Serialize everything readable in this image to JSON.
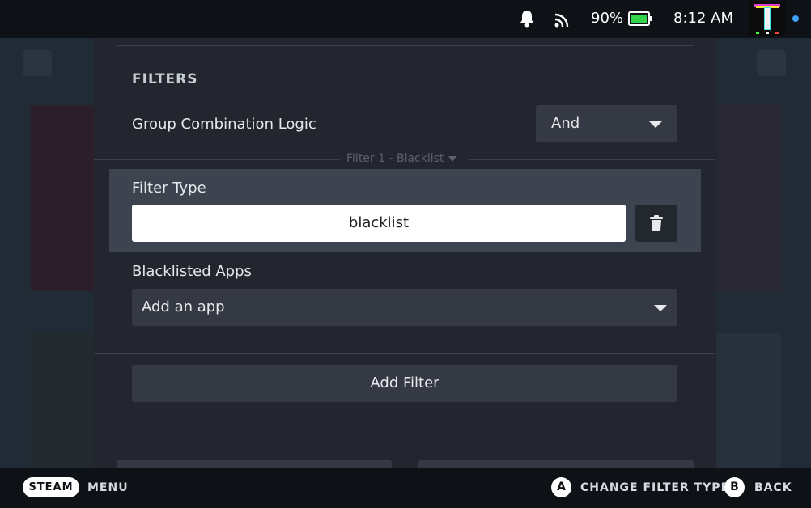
{
  "status_bar": {
    "battery_percent": "90%",
    "time": "8:12 AM",
    "avatar_letter": "T"
  },
  "filters_panel": {
    "section_title": "FILTERS",
    "group_logic": {
      "label": "Group Combination Logic",
      "selected": "And"
    },
    "filter_1": {
      "header": "Filter 1 - Blacklist",
      "type_label": "Filter Type",
      "type_value": "blacklist",
      "apps_label": "Blacklisted Apps",
      "apps_placeholder": "Add an app"
    },
    "add_filter_label": "Add Filter"
  },
  "bottom_bar": {
    "steam_label": "STEAM",
    "menu_label": "MENU",
    "a_button": "A",
    "a_action": "CHANGE FILTER TYPE",
    "b_button": "B",
    "b_action": "BACK"
  },
  "colors": {
    "highlight": "#3d4450",
    "accent_dot": "#3ea3ff",
    "battery": "#35d34a"
  }
}
